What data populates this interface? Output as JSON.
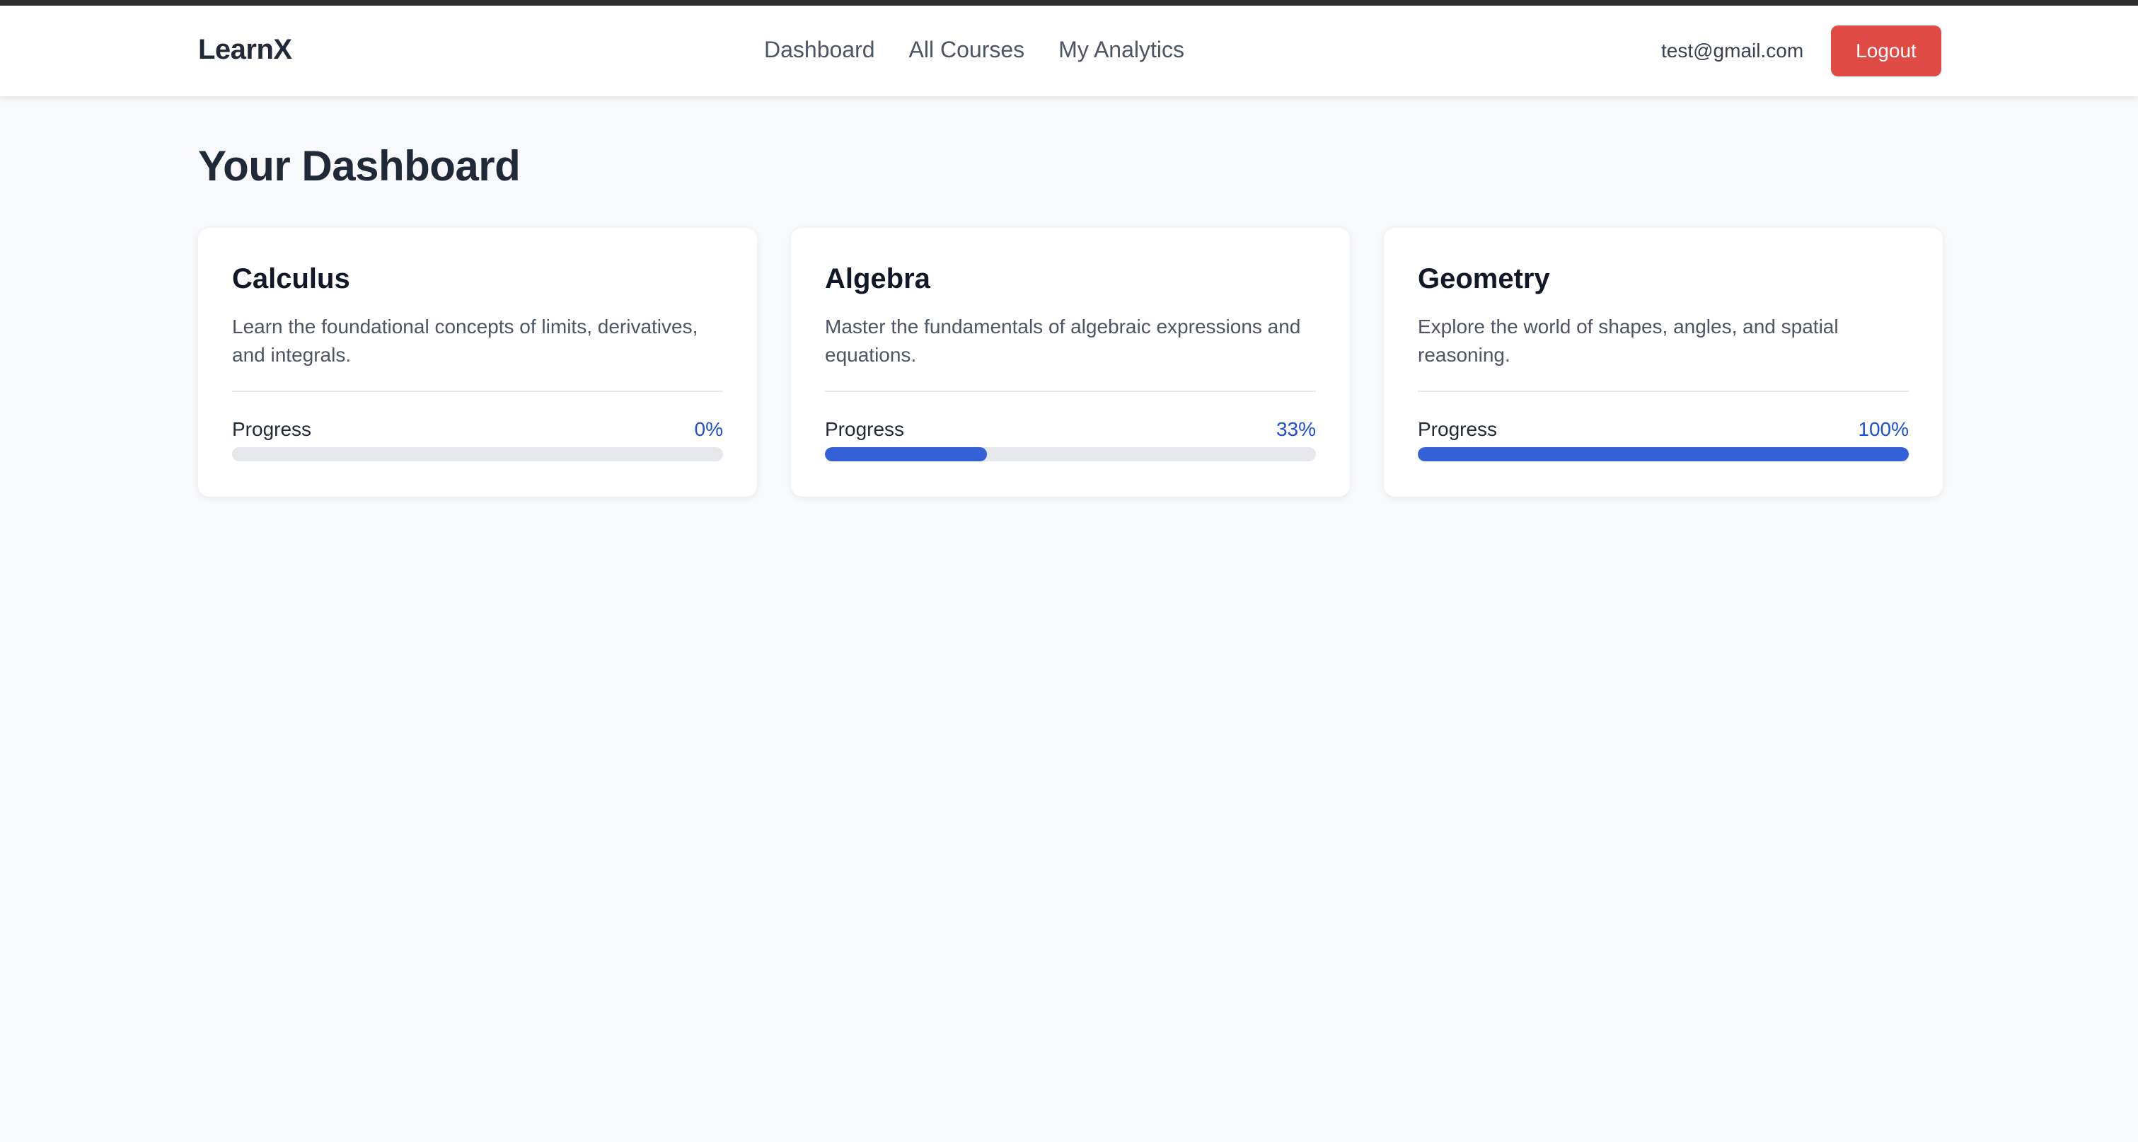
{
  "header": {
    "brand": "LearnX",
    "nav": [
      "Dashboard",
      "All Courses",
      "My Analytics"
    ],
    "user_email": "test@gmail.com",
    "logout_label": "Logout"
  },
  "page": {
    "title": "Your Dashboard"
  },
  "courses": [
    {
      "title": "Calculus",
      "description": "Learn the foundational concepts of limits, derivatives, and integrals.",
      "progress_label": "Progress",
      "progress_text": "0%",
      "progress": 0
    },
    {
      "title": "Algebra",
      "description": "Master the fundamentals of algebraic expressions and equations.",
      "progress_label": "Progress",
      "progress_text": "33%",
      "progress": 33
    },
    {
      "title": "Geometry",
      "description": "Explore the world of shapes, angles, and spatial reasoning.",
      "progress_label": "Progress",
      "progress_text": "100%",
      "progress": 100
    }
  ],
  "colors": {
    "accent": "#3461d8",
    "logout": "#df4a45",
    "progress_text": "#1d4ed8"
  }
}
